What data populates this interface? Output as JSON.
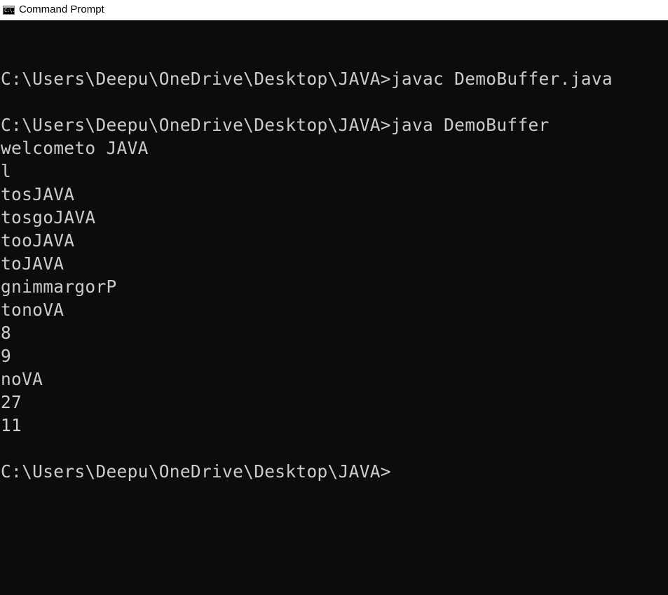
{
  "window": {
    "title": "Command Prompt",
    "icon": "console-window-icon",
    "icon_text": "C:\\."
  },
  "console": {
    "lines": [
      "",
      "C:\\Users\\Deepu\\OneDrive\\Desktop\\JAVA>javac DemoBuffer.java",
      "",
      "C:\\Users\\Deepu\\OneDrive\\Desktop\\JAVA>java DemoBuffer",
      "welcometo JAVA",
      "l",
      "tosJAVA",
      "tosgoJAVA",
      "tooJAVA",
      "toJAVA",
      "gnimmargorP",
      "tonoVA",
      "8",
      "9",
      "noVA",
      "27",
      "11",
      "",
      "C:\\Users\\Deepu\\OneDrive\\Desktop\\JAVA>"
    ]
  },
  "colors": {
    "background": "#0c0c0c",
    "foreground": "#cccccc",
    "titlebar": "#ffffff"
  }
}
